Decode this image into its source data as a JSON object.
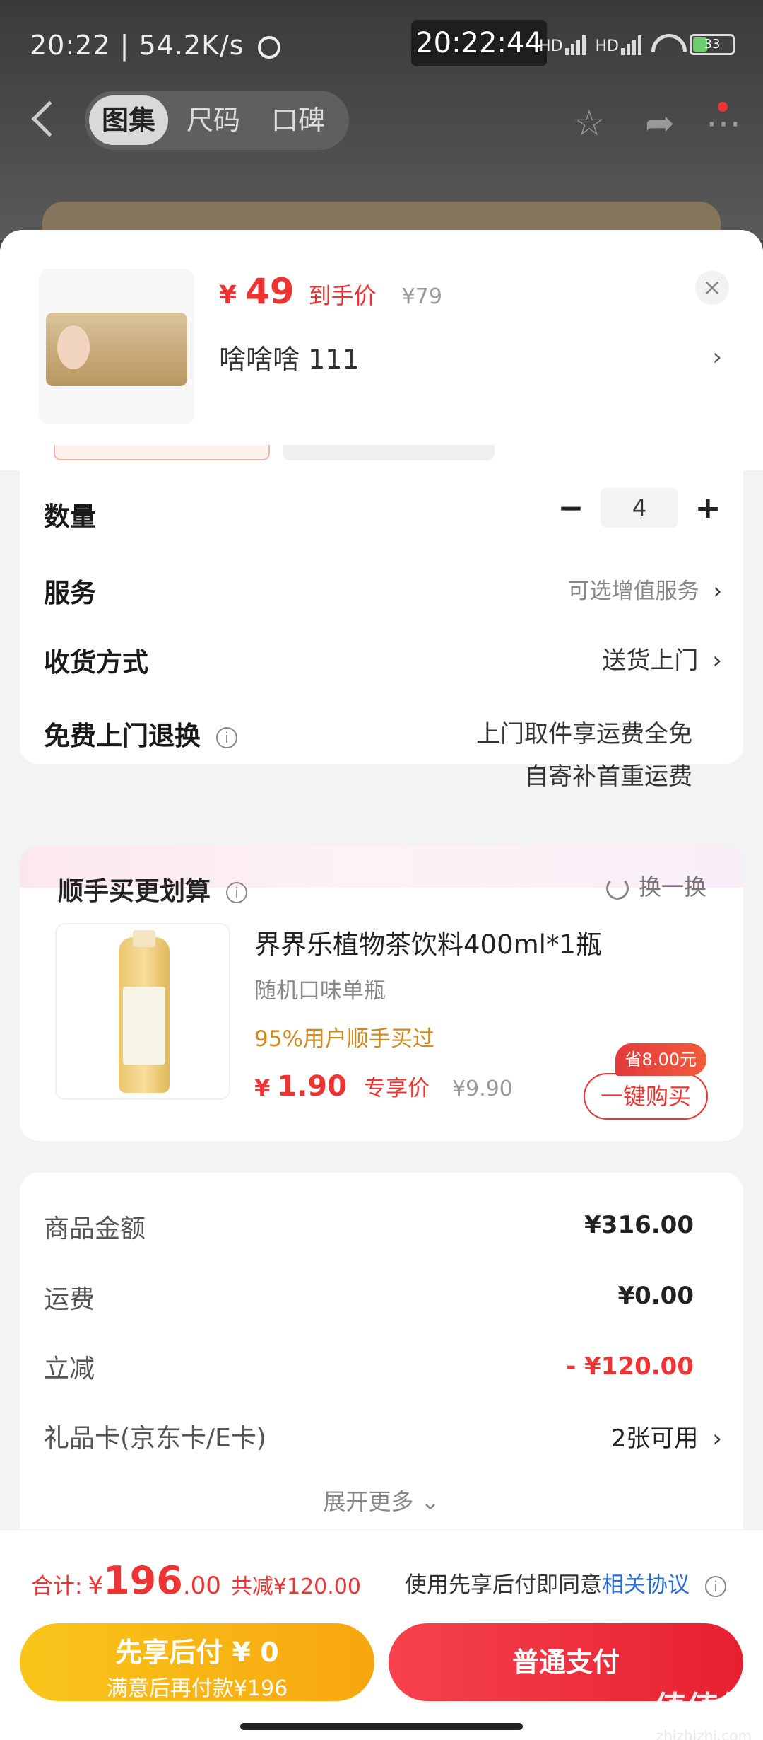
{
  "status_bar": {
    "time_speed": "20:22 | 54.2K/s",
    "screenshot_time": "20:22:44",
    "battery": "33",
    "net1": "HD",
    "net2": "HD"
  },
  "nav": {
    "tabs": [
      "图集",
      "尺码",
      "口碑"
    ]
  },
  "product": {
    "currency": "¥",
    "price": "49",
    "price_tag": "到手价",
    "original_price": "¥79",
    "spec": "啥啥啥  111",
    "close": "×",
    "arrow": "›"
  },
  "options": {
    "quantity_label": "数量",
    "quantity_value": "4",
    "minus": "−",
    "plus": "+",
    "service_label": "服务",
    "service_value": "可选增值服务",
    "delivery_label": "收货方式",
    "delivery_value": "送货上门",
    "return_label": "免费上门退换",
    "return_line1": "上门取件享运费全免",
    "return_line2": "自寄补首重运费",
    "chevron": "›",
    "info": "i"
  },
  "addon": {
    "title": "顺手买更划算",
    "swap": "换一换",
    "name": "界界乐植物茶饮料400ml*1瓶",
    "sub": "随机口味单瓶",
    "popularity": "95%用户顺手买过",
    "currency": "¥",
    "price": "1.90",
    "price_tag": "专享价",
    "original_price": "¥9.90",
    "save": "省8.00元",
    "buy": "一键购买"
  },
  "fees": {
    "goods_label": "商品金额",
    "goods_value": "¥316.00",
    "shipping_label": "运费",
    "shipping_value": "¥0.00",
    "discount_label": "立减",
    "discount_value": "- ¥120.00",
    "giftcard_label": "礼品卡(京东卡/E卡)",
    "giftcard_value": "2张可用",
    "more": "展开更多 ⌄"
  },
  "footer": {
    "total_label": "合计:",
    "currency": "¥",
    "total_int": "196",
    "total_dec": ".00",
    "saved": "共减¥120.00",
    "agree_prefix": "使用先享后付即同意",
    "agree_link": "相关协议",
    "pay_later_title": "先享后付 ¥ 0",
    "pay_later_sub": "满意后再付款¥196",
    "pay_now": "普通支付"
  },
  "watermark": {
    "text": "値値値",
    "url": "zhizhizhi.com"
  },
  "colors": {
    "accent_red": "#e33333",
    "pay_later_yellow": "#f8b514",
    "pay_now_red": "#ee3040"
  }
}
